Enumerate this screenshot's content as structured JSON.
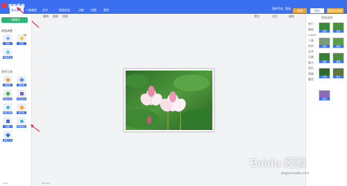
{
  "app": {
    "name": "美图秀秀"
  },
  "nav": {
    "tabs": [
      "美化图片",
      "人像美容",
      "文字",
      "贴纸饰品",
      "边框",
      "拼图",
      "更多"
    ],
    "right": [
      "我的手机",
      "登录"
    ]
  },
  "toolbar": {
    "new_label": "新建",
    "save_label": "保存",
    "save_share_label": "保存与分享"
  },
  "canvas_toolbar": {
    "items": [
      "撤销",
      "重做",
      "原图"
    ],
    "right": [
      "预览",
      "对比",
      "缩放"
    ]
  },
  "sidebar": {
    "open_button": "一键美化",
    "section1": "增强调整",
    "section1_items": [
      {
        "label": "调色",
        "icon": "palette-icon",
        "badge": ""
      },
      {
        "label": "增强",
        "icon": "enhance-icon",
        "badge": "新"
      },
      {
        "label": "局部变色",
        "icon": "color-icon",
        "badge": "新"
      }
    ],
    "section2": "其他工具",
    "section2_items": [
      {
        "label": "涂鸦笔",
        "icon": "brush-icon",
        "badge": ""
      },
      {
        "label": "消除笔",
        "icon": "eraser-icon",
        "badge": ""
      },
      {
        "label": "局部彩色笔",
        "icon": "pen-icon",
        "badge": ""
      },
      {
        "label": "背景虚化",
        "icon": "blur-icon",
        "badge": ""
      },
      {
        "label": "局部马赛克",
        "icon": "mosaic-icon",
        "badge": ""
      },
      {
        "label": "魔幻笔",
        "icon": "magic-icon",
        "badge": ""
      },
      {
        "label": "抠图",
        "icon": "cutout-icon",
        "badge": ""
      },
      {
        "label": "智能美化",
        "icon": "smart-icon",
        "badge": ""
      },
      {
        "label": "画笔工具",
        "icon": "brush2-icon",
        "badge": ""
      }
    ]
  },
  "rightpanel": {
    "title": "特效滤镜",
    "categories": [
      "热门",
      "基础",
      "LOMO",
      "人像",
      "时尚",
      "艺术",
      "风景",
      "复古",
      "黑白",
      "高级",
      "暖色"
    ],
    "thumbs": [
      "原图",
      "自然",
      "清新",
      "暖暖",
      "优雅",
      "甜美",
      "冷绿",
      "复古",
      "紫调"
    ]
  },
  "status": {
    "zoom": "100%",
    "size": "500×269"
  },
  "watermark": {
    "text": "Baidu 经验",
    "sub": "jingyan.baidu.com"
  },
  "colors": {
    "primary": "#3a6ff0",
    "accent": "#2bb673",
    "red": "#e8344e"
  }
}
